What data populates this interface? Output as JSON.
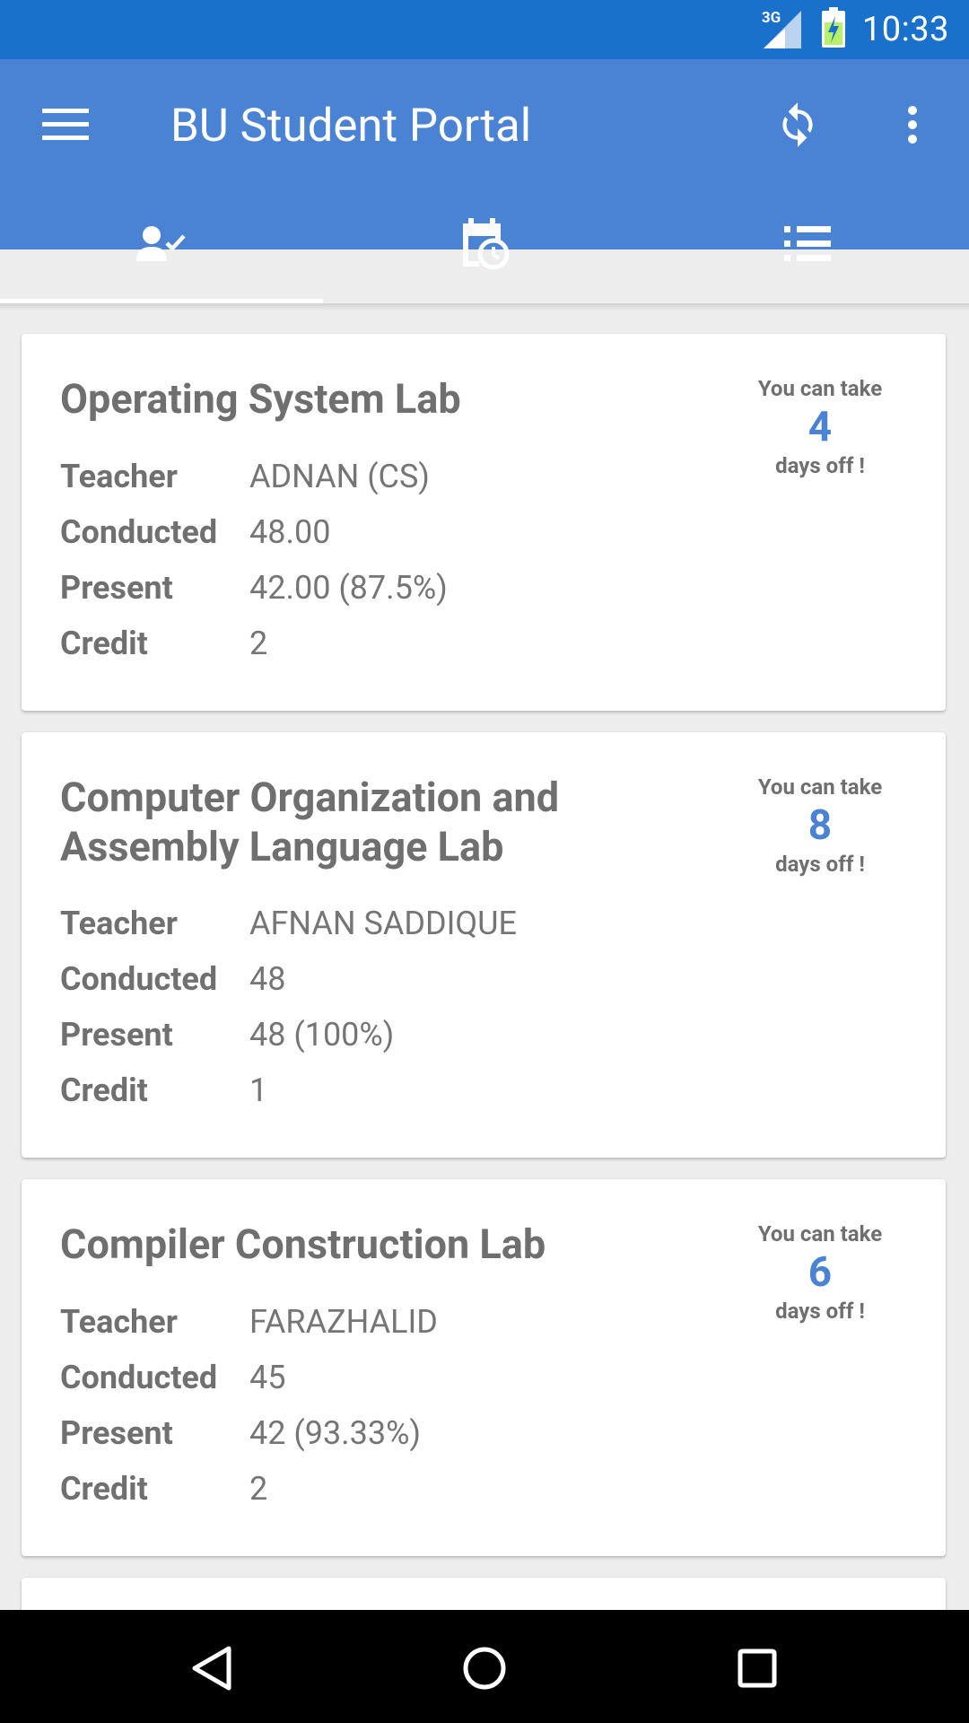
{
  "status_bar": {
    "network_type": "3G",
    "time": "10:33",
    "icons": [
      "signal-icon",
      "battery-charging-icon"
    ],
    "color": "#1a71cc"
  },
  "app_bar": {
    "title": "BU Student Portal",
    "color": "#4a83d3",
    "icons": [
      "menu-icon",
      "sync-icon",
      "more-vert-icon"
    ]
  },
  "tabs": [
    {
      "icon": "attendance-icon",
      "selected": true
    },
    {
      "icon": "calendar-clock-icon",
      "selected": false
    },
    {
      "icon": "list-icon",
      "selected": false
    }
  ],
  "labels": {
    "teacher": "Teacher",
    "conducted": "Conducted",
    "present": "Present",
    "credit": "Credit",
    "days_off_top": "You can take",
    "days_off_bottom": "days off !"
  },
  "courses": [
    {
      "title": "Operating System Lab",
      "teacher": "ADNAN (CS)",
      "conducted": "48.00",
      "present": "42.00 (87.5%)",
      "credit": "2",
      "days_off": "4"
    },
    {
      "title": "Computer Organization and Assembly Language Lab",
      "teacher": "AFNAN SADDIQUE",
      "conducted": "48",
      "present": "48 (100%)",
      "credit": "1",
      "days_off": "8"
    },
    {
      "title": "Compiler Construction Lab",
      "teacher": "FARAZHALID",
      "conducted": "45",
      "present": "42 (93.33%)",
      "credit": "2",
      "days_off": "6"
    }
  ],
  "accent_color": "#4a83d3",
  "nav_bar": {
    "icons": [
      "back-icon",
      "home-icon",
      "recents-icon"
    ]
  }
}
